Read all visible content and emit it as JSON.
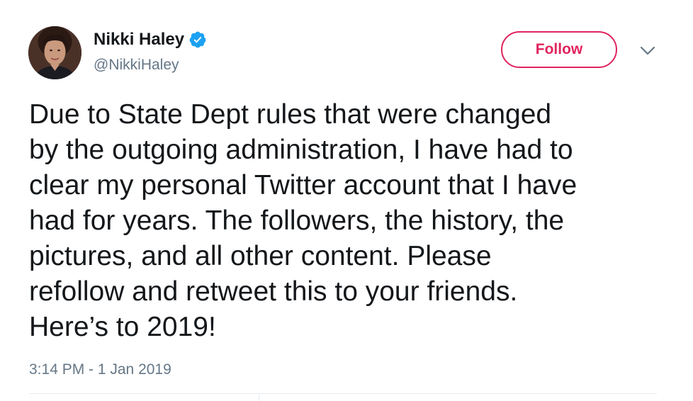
{
  "tweet": {
    "author": {
      "display_name": "Nikki Haley",
      "handle": "@NikkiHaley",
      "verified": true,
      "avatar_icon": "profile-photo"
    },
    "follow_label": "Follow",
    "menu_icon": "chevron-down-icon",
    "text_lines": [
      "Due to State Dept rules that were changed",
      "by the outgoing administration, I have had to",
      "clear my personal Twitter account that I have",
      "had for years. The followers, the history, the",
      "pictures, and all other content. Please",
      "refollow and retweet this to your friends.",
      "Here’s to 2019!"
    ],
    "timestamp": "3:14 PM - 1 Jan 2019"
  },
  "colors": {
    "follow_accent": "#e0245e",
    "verified_blue": "#1da1f2",
    "secondary_text": "#657786",
    "primary_text": "#14171a"
  }
}
